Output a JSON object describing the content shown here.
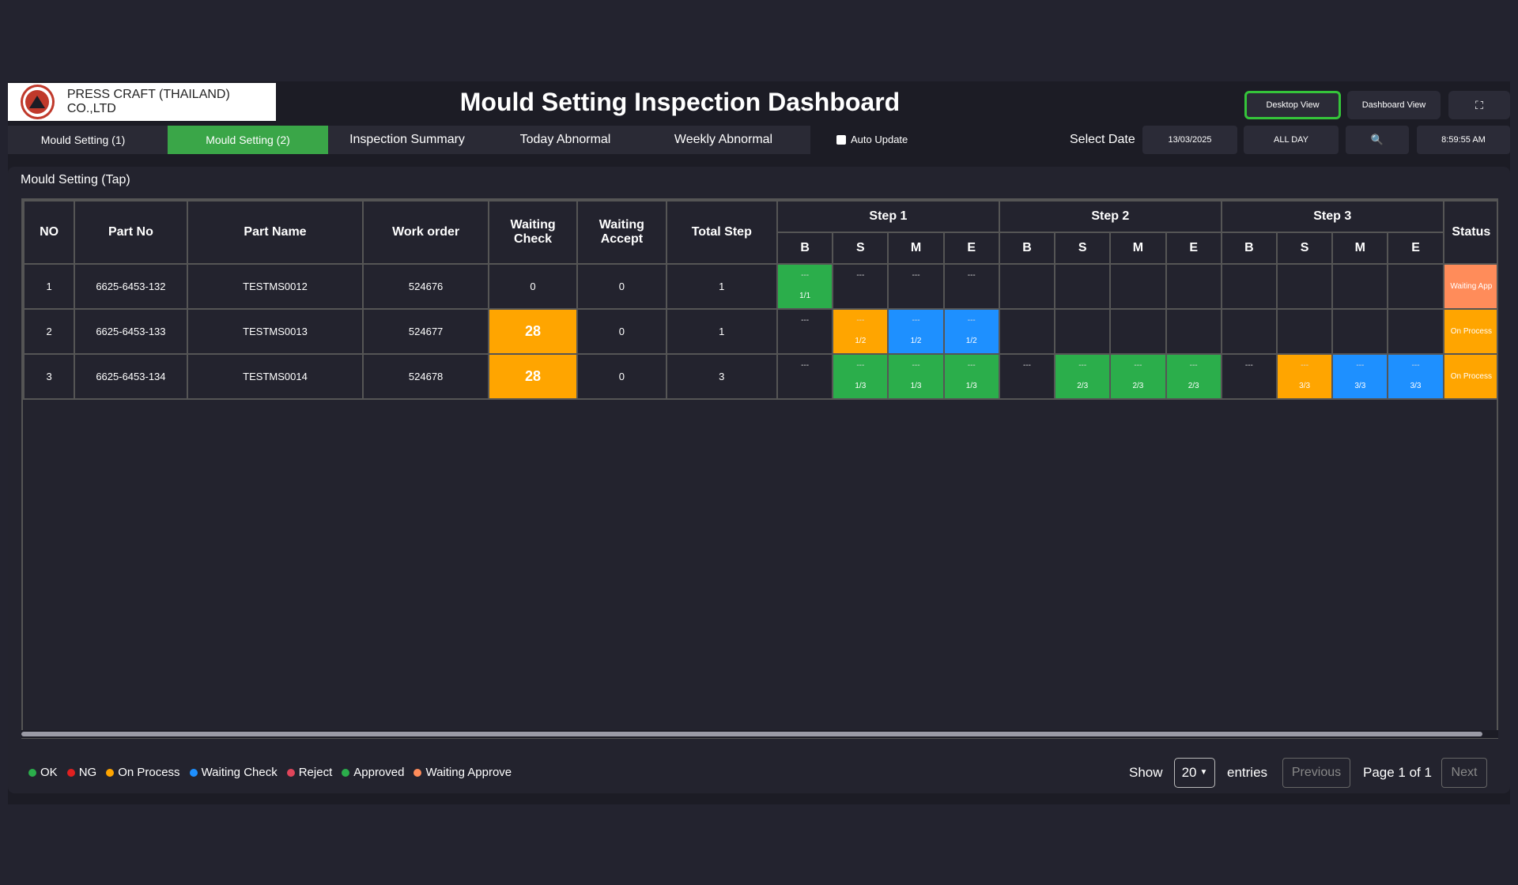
{
  "header": {
    "company": "PRESS CRAFT (THAILAND) CO.,LTD",
    "title": "Mould Setting Inspection Dashboard",
    "desktop_view": "Desktop View",
    "dashboard_view": "Dashboard View",
    "fullscreen_icon": "⛶"
  },
  "tabs": [
    {
      "label": "Mould  Setting (1)"
    },
    {
      "label": "Mould  Setting (2)"
    },
    {
      "label": "Inspection Summary"
    },
    {
      "label": "Today Abnormal"
    },
    {
      "label": "Weekly Abnormal"
    }
  ],
  "controls": {
    "auto_update": "Auto Update",
    "select_date": "Select Date",
    "date": "13/03/2025",
    "range": "ALL DAY",
    "search_icon": "🔍",
    "time": "8:59:55 AM"
  },
  "panel": {
    "title": "Mould Setting (Tap)"
  },
  "table": {
    "headers": {
      "no": "NO",
      "part_no": "Part No",
      "part_name": "Part Name",
      "work_order": "Work order",
      "waiting_check_1": "Waiting",
      "waiting_check_2": "Check",
      "waiting_accept_1": "Waiting",
      "waiting_accept_2": "Accept",
      "total_step": "Total Step",
      "step1": "Step 1",
      "step2": "Step 2",
      "step3": "Step 3",
      "status": "Status",
      "sub": [
        "B",
        "S",
        "M",
        "E"
      ]
    },
    "rows": [
      {
        "no": "1",
        "part_no": "6625-6453-132",
        "part_name": "TESTMS0012",
        "work_order": "524676",
        "waiting_check": "0",
        "waiting_accept": "0",
        "total_step": "1",
        "status": "Waiting App"
      },
      {
        "no": "2",
        "part_no": "6625-6453-133",
        "part_name": "TESTMS0013",
        "work_order": "524677",
        "waiting_check": "28",
        "waiting_accept": "0",
        "total_step": "1",
        "status": "On Process"
      },
      {
        "no": "3",
        "part_no": "6625-6453-134",
        "part_name": "TESTMS0014",
        "work_order": "524678",
        "waiting_check": "28",
        "waiting_accept": "0",
        "total_step": "3",
        "status": "On Process"
      }
    ],
    "cells": {
      "r1_b": {
        "top": "---",
        "frac": "1/1"
      },
      "r1_s": {
        "top": "---"
      },
      "r1_m": {
        "top": "---"
      },
      "r1_e": {
        "top": "---"
      },
      "r2_b": {
        "top": "---"
      },
      "r2_s": {
        "top": "---",
        "frac": "1/2"
      },
      "r2_m": {
        "top": "---",
        "frac": "1/2"
      },
      "r2_e": {
        "top": "---",
        "frac": "1/2"
      },
      "r3_s1b": {
        "top": "---"
      },
      "r3_s1s": {
        "top": "---",
        "frac": "1/3"
      },
      "r3_s1m": {
        "top": "---",
        "frac": "1/3"
      },
      "r3_s1e": {
        "top": "---",
        "frac": "1/3"
      },
      "r3_s2b": {
        "top": "---"
      },
      "r3_s2s": {
        "top": "---",
        "frac": "2/3"
      },
      "r3_s2m": {
        "top": "---",
        "frac": "2/3"
      },
      "r3_s2e": {
        "top": "---",
        "frac": "2/3"
      },
      "r3_s3b": {
        "top": "---"
      },
      "r3_s3s": {
        "top": "---",
        "frac": "3/3"
      },
      "r3_s3m": {
        "top": "---",
        "frac": "3/3"
      },
      "r3_s3e": {
        "top": "---",
        "frac": "3/3"
      }
    }
  },
  "legend": [
    {
      "label": "OK",
      "color": "#2bae4b"
    },
    {
      "label": "NG",
      "color": "#e02020"
    },
    {
      "label": "On Process",
      "color": "#ffa500"
    },
    {
      "label": "Waiting Check",
      "color": "#1e90ff"
    },
    {
      "label": "Reject",
      "color": "#e0455a"
    },
    {
      "label": "Approved",
      "color": "#2bae4b"
    },
    {
      "label": "Waiting Approve",
      "color": "#ff8c5a"
    }
  ],
  "pager": {
    "show": "Show",
    "page_size": "20",
    "entries": "entries",
    "previous": "Previous",
    "page_info": "Page 1 of 1",
    "next": "Next"
  }
}
